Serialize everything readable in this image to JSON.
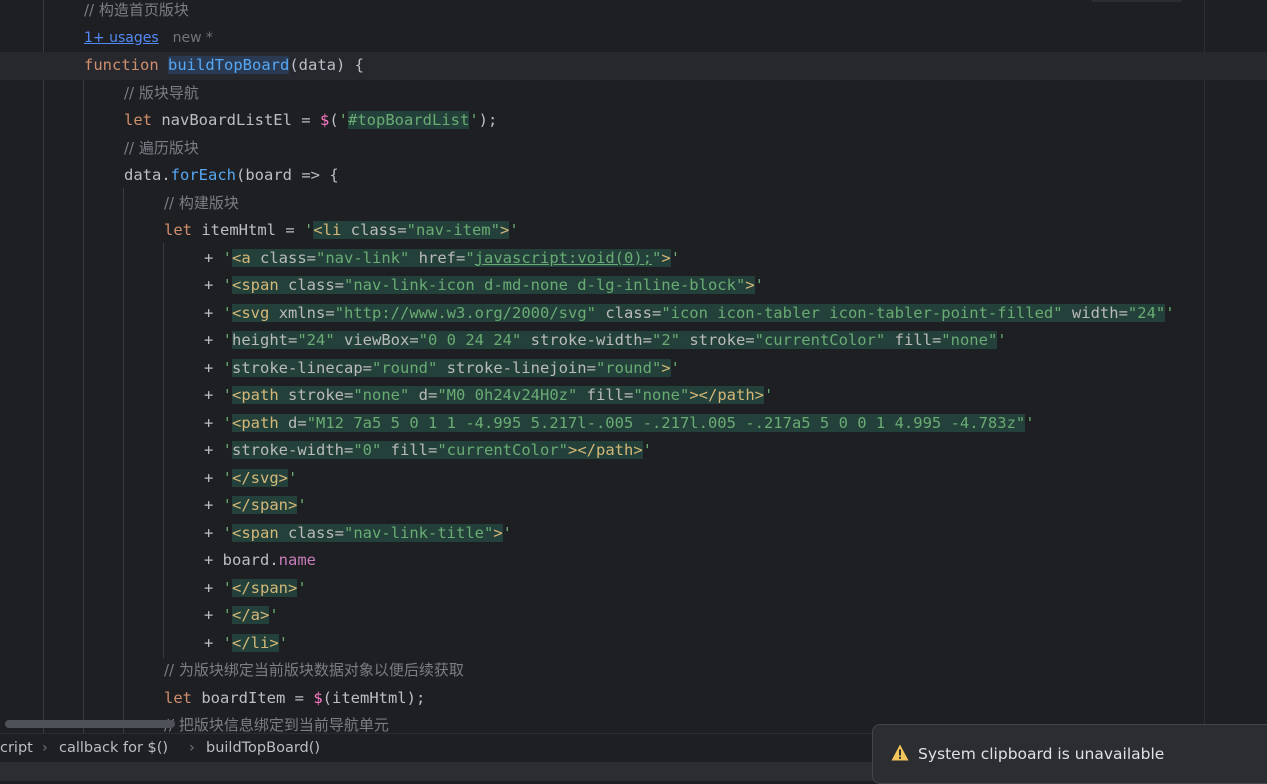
{
  "editor": {
    "hint": {
      "usages": "1+ usages",
      "new": "new *"
    },
    "lines": [
      {
        "indent": 0,
        "parts": [
          {
            "c": "comment",
            "t": "// 构造首页版块"
          }
        ]
      },
      {
        "type": "hint"
      },
      {
        "indent": 0,
        "current": true,
        "parts": [
          {
            "c": "kw",
            "t": "function "
          },
          {
            "c": "fn-decl",
            "t": "buildTopBoard"
          },
          {
            "c": "plain",
            "t": "(data) {"
          }
        ]
      },
      {
        "indent": 1,
        "parts": [
          {
            "c": "comment",
            "t": "// 版块导航"
          }
        ]
      },
      {
        "indent": 1,
        "parts": [
          {
            "c": "kw",
            "t": "let "
          },
          {
            "c": "plain",
            "t": "navBoardListEl = "
          },
          {
            "c": "dollar",
            "t": "$"
          },
          {
            "c": "plain",
            "t": "("
          },
          {
            "c": "str",
            "t": "'"
          },
          {
            "c": "str-inj",
            "t": "#topBoardList"
          },
          {
            "c": "str",
            "t": "'"
          },
          {
            "c": "plain",
            "t": ");"
          }
        ]
      },
      {
        "indent": 1,
        "parts": [
          {
            "c": "comment",
            "t": "// 遍历版块"
          }
        ]
      },
      {
        "indent": 1,
        "parts": [
          {
            "c": "plain",
            "t": "data."
          },
          {
            "c": "fn",
            "t": "forEach"
          },
          {
            "c": "plain",
            "t": "(board => {"
          }
        ]
      },
      {
        "indent": 2,
        "parts": [
          {
            "c": "comment",
            "t": "// 构建版块"
          }
        ]
      },
      {
        "indent": 2,
        "parts": [
          {
            "c": "kw",
            "t": "let "
          },
          {
            "c": "plain",
            "t": "itemHtml = "
          },
          {
            "c": "str",
            "t": "'"
          },
          {
            "c": "tag",
            "t": "<li ",
            "bg": true
          },
          {
            "c": "attr",
            "t": "class=",
            "bg": true
          },
          {
            "c": "str",
            "t": "\"nav-item\"",
            "bg": true
          },
          {
            "c": "tag",
            "t": ">",
            "bg": true
          },
          {
            "c": "str",
            "t": "'"
          }
        ]
      },
      {
        "indent": 3,
        "parts": [
          {
            "c": "op",
            "t": "+ "
          },
          {
            "c": "str",
            "t": "'"
          },
          {
            "c": "tag",
            "t": "<a ",
            "bg": true
          },
          {
            "c": "attr",
            "t": "class=",
            "bg": true
          },
          {
            "c": "str",
            "t": "\"nav-link\" ",
            "bg": true
          },
          {
            "c": "attr",
            "t": "href=",
            "bg": true
          },
          {
            "c": "str",
            "t": "\"",
            "bg": true
          },
          {
            "c": "str url",
            "t": "javascript:void(0);",
            "bg": true
          },
          {
            "c": "str",
            "t": "\"",
            "bg": true
          },
          {
            "c": "tag",
            "t": ">",
            "bg": true
          },
          {
            "c": "str",
            "t": "'"
          }
        ]
      },
      {
        "indent": 3,
        "parts": [
          {
            "c": "op",
            "t": "+ "
          },
          {
            "c": "str",
            "t": "'"
          },
          {
            "c": "tag",
            "t": "<span ",
            "bg": true
          },
          {
            "c": "attr",
            "t": "class=",
            "bg": true
          },
          {
            "c": "str",
            "t": "\"nav-link-icon d-md-none d-lg-inline-block\"",
            "bg": true
          },
          {
            "c": "tag",
            "t": ">",
            "bg": true
          },
          {
            "c": "str",
            "t": "'"
          }
        ]
      },
      {
        "indent": 3,
        "parts": [
          {
            "c": "op",
            "t": "+ "
          },
          {
            "c": "str",
            "t": "'"
          },
          {
            "c": "tag",
            "t": "<svg ",
            "bg": true
          },
          {
            "c": "attr",
            "t": "xmlns=",
            "bg": true
          },
          {
            "c": "str",
            "t": "\"http://www.w3.org/2000/svg\" ",
            "bg": true
          },
          {
            "c": "attr",
            "t": "class=",
            "bg": true
          },
          {
            "c": "str",
            "t": "\"icon icon-tabler icon-tabler-point-filled\" ",
            "bg": true
          },
          {
            "c": "attr",
            "t": "width=",
            "bg": true
          },
          {
            "c": "str",
            "t": "\"24\"",
            "bg": true
          },
          {
            "c": "str",
            "t": "'"
          }
        ]
      },
      {
        "indent": 3,
        "parts": [
          {
            "c": "op",
            "t": "+ "
          },
          {
            "c": "str",
            "t": "'"
          },
          {
            "c": "attr",
            "t": "height=",
            "bg": true
          },
          {
            "c": "str",
            "t": "\"24\" ",
            "bg": true
          },
          {
            "c": "attr",
            "t": "viewBox=",
            "bg": true
          },
          {
            "c": "str",
            "t": "\"0 0 24 24\" ",
            "bg": true
          },
          {
            "c": "attr",
            "t": "stroke-width=",
            "bg": true
          },
          {
            "c": "str",
            "t": "\"2\" ",
            "bg": true
          },
          {
            "c": "attr",
            "t": "stroke=",
            "bg": true
          },
          {
            "c": "str",
            "t": "\"currentColor\" ",
            "bg": true
          },
          {
            "c": "attr",
            "t": "fill=",
            "bg": true
          },
          {
            "c": "str",
            "t": "\"none\"",
            "bg": true
          },
          {
            "c": "str",
            "t": "'"
          }
        ]
      },
      {
        "indent": 3,
        "parts": [
          {
            "c": "op",
            "t": "+ "
          },
          {
            "c": "str",
            "t": "'"
          },
          {
            "c": "attr",
            "t": "stroke-linecap=",
            "bg": true
          },
          {
            "c": "str",
            "t": "\"round\" ",
            "bg": true
          },
          {
            "c": "attr",
            "t": "stroke-linejoin=",
            "bg": true
          },
          {
            "c": "str",
            "t": "\"round\"",
            "bg": true
          },
          {
            "c": "tag",
            "t": ">",
            "bg": true
          },
          {
            "c": "str",
            "t": "'"
          }
        ]
      },
      {
        "indent": 3,
        "parts": [
          {
            "c": "op",
            "t": "+ "
          },
          {
            "c": "str",
            "t": "'"
          },
          {
            "c": "tag",
            "t": "<path ",
            "bg": true
          },
          {
            "c": "attr",
            "t": "stroke=",
            "bg": true
          },
          {
            "c": "str",
            "t": "\"none\" ",
            "bg": true
          },
          {
            "c": "attr",
            "t": "d=",
            "bg": true
          },
          {
            "c": "str",
            "t": "\"M0 0h24v24H0z\" ",
            "bg": true
          },
          {
            "c": "attr",
            "t": "fill=",
            "bg": true
          },
          {
            "c": "str",
            "t": "\"none\"",
            "bg": true
          },
          {
            "c": "tag",
            "t": "></path>",
            "bg": true
          },
          {
            "c": "str",
            "t": "'"
          }
        ]
      },
      {
        "indent": 3,
        "parts": [
          {
            "c": "op",
            "t": "+ "
          },
          {
            "c": "str",
            "t": "'"
          },
          {
            "c": "tag",
            "t": "<path ",
            "bg": true
          },
          {
            "c": "attr",
            "t": "d=",
            "bg": true
          },
          {
            "c": "str",
            "t": "\"M12 7a5 5 0 1 1 -4.995 5.217l-.005 -.217l.005 -.217a5 5 0 0 1 4.995 -4.783z\"",
            "bg": true
          },
          {
            "c": "str",
            "t": "'"
          }
        ]
      },
      {
        "indent": 3,
        "parts": [
          {
            "c": "op",
            "t": "+ "
          },
          {
            "c": "str",
            "t": "'"
          },
          {
            "c": "attr",
            "t": "stroke-width=",
            "bg": true
          },
          {
            "c": "str",
            "t": "\"0\" ",
            "bg": true
          },
          {
            "c": "attr",
            "t": "fill=",
            "bg": true
          },
          {
            "c": "str",
            "t": "\"currentColor\"",
            "bg": true
          },
          {
            "c": "tag",
            "t": "></path>",
            "bg": true
          },
          {
            "c": "str",
            "t": "'"
          }
        ]
      },
      {
        "indent": 3,
        "parts": [
          {
            "c": "op",
            "t": "+ "
          },
          {
            "c": "str",
            "t": "'"
          },
          {
            "c": "tag",
            "t": "</svg>",
            "bg": true
          },
          {
            "c": "str",
            "t": "'"
          }
        ]
      },
      {
        "indent": 3,
        "parts": [
          {
            "c": "op",
            "t": "+ "
          },
          {
            "c": "str",
            "t": "'"
          },
          {
            "c": "tag",
            "t": "</span>",
            "bg": true
          },
          {
            "c": "str",
            "t": "'"
          }
        ]
      },
      {
        "indent": 3,
        "parts": [
          {
            "c": "op",
            "t": "+ "
          },
          {
            "c": "str",
            "t": "'"
          },
          {
            "c": "tag",
            "t": "<span ",
            "bg": true
          },
          {
            "c": "attr",
            "t": "class=",
            "bg": true
          },
          {
            "c": "str",
            "t": "\"nav-link-title\"",
            "bg": true
          },
          {
            "c": "tag",
            "t": ">",
            "bg": true
          },
          {
            "c": "str",
            "t": "'"
          }
        ]
      },
      {
        "indent": 3,
        "parts": [
          {
            "c": "op",
            "t": "+ "
          },
          {
            "c": "plain",
            "t": "board."
          },
          {
            "c": "prop",
            "t": "name"
          }
        ]
      },
      {
        "indent": 3,
        "parts": [
          {
            "c": "op",
            "t": "+ "
          },
          {
            "c": "str",
            "t": "'"
          },
          {
            "c": "tag",
            "t": "</span>",
            "bg": true
          },
          {
            "c": "str",
            "t": "'"
          }
        ]
      },
      {
        "indent": 3,
        "parts": [
          {
            "c": "op",
            "t": "+ "
          },
          {
            "c": "str",
            "t": "'"
          },
          {
            "c": "tag",
            "t": "</a>",
            "bg": true
          },
          {
            "c": "str",
            "t": "'"
          }
        ]
      },
      {
        "indent": 3,
        "parts": [
          {
            "c": "op",
            "t": "+ "
          },
          {
            "c": "str",
            "t": "'"
          },
          {
            "c": "tag",
            "t": "</li>",
            "bg": true
          },
          {
            "c": "str",
            "t": "'"
          }
        ]
      },
      {
        "indent": 2,
        "parts": [
          {
            "c": "comment",
            "t": "// 为版块绑定当前版块数据对象以便后续获取"
          }
        ]
      },
      {
        "indent": 2,
        "parts": [
          {
            "c": "kw",
            "t": "let "
          },
          {
            "c": "plain",
            "t": "boardItem = "
          },
          {
            "c": "dollar",
            "t": "$"
          },
          {
            "c": "plain",
            "t": "(itemHtml);"
          }
        ]
      },
      {
        "indent": 2,
        "parts": [
          {
            "c": "comment",
            "t": "// 把版块信息绑定到当前导航单元"
          }
        ]
      }
    ]
  },
  "breadcrumbs": {
    "items": [
      "cript",
      "callback for $()",
      "buildTopBoard()"
    ],
    "separator": "›"
  },
  "notification": {
    "message": "System clipboard is unavailable",
    "icon": "warning-icon",
    "icon_color": "#f2c55c"
  }
}
